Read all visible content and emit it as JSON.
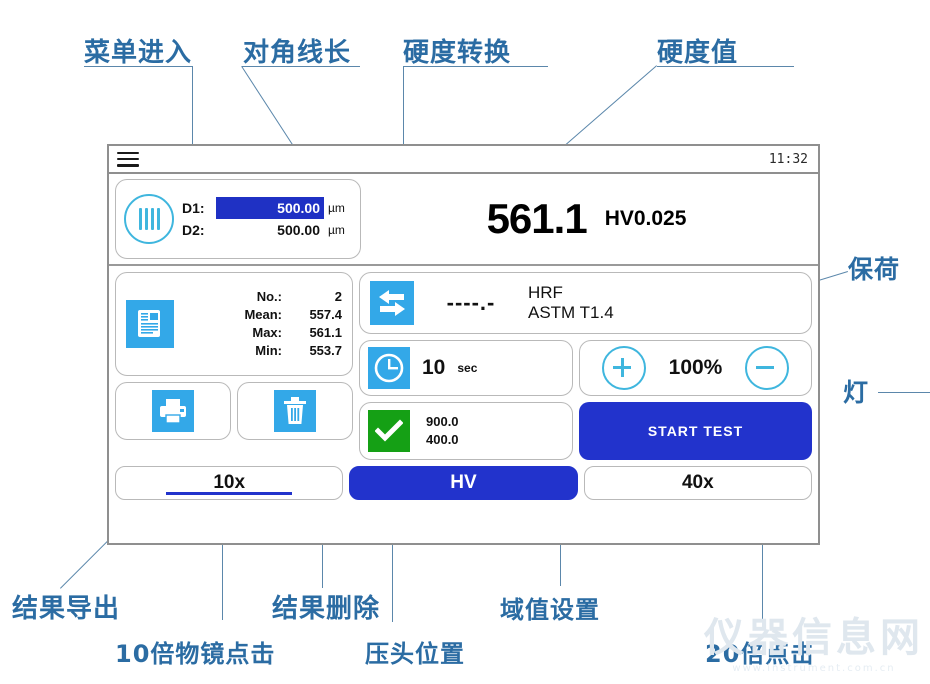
{
  "device": {
    "titlebar": {
      "menu_icon": "hamburger-menu-icon",
      "clock": "11:32"
    },
    "diagonal": {
      "icon": "indent-diagonal-icon",
      "rows": [
        {
          "label": "D1:",
          "value": "500.00",
          "unit": "µm",
          "selected": true
        },
        {
          "label": "D2:",
          "value": "500.00",
          "unit": "µm",
          "selected": false
        }
      ]
    },
    "hardness": {
      "value": "561.1",
      "scale": "HV0.025"
    },
    "stats": {
      "icon": "report-document-icon",
      "rows": [
        {
          "key": "No.:",
          "value": "2"
        },
        {
          "key": "Mean:",
          "value": "557.4"
        },
        {
          "key": "Max:",
          "value": "561.1"
        },
        {
          "key": "Min:",
          "value": "553.7"
        }
      ]
    },
    "tools": [
      {
        "name": "print-button",
        "icon": "printer-icon"
      },
      {
        "name": "delete-button",
        "icon": "trash-icon"
      }
    ],
    "conversion": {
      "icon": "convert-arrows-icon",
      "value": "----.-",
      "scale": "HRF",
      "standard": "ASTM T1.4"
    },
    "dwell": {
      "icon": "clock-icon",
      "value": "10",
      "unit": "sec"
    },
    "light": {
      "plus_icon": "plus-circle-icon",
      "minus_icon": "minus-circle-icon",
      "value": "100%"
    },
    "threshold": {
      "icon": "check-mark-icon",
      "upper": "900.0",
      "lower": "400.0"
    },
    "start_test": {
      "label": "START TEST"
    },
    "zoom_buttons": [
      {
        "label": "10x",
        "active": false,
        "underlined": true
      },
      {
        "label": "HV",
        "active": true,
        "underlined": false
      },
      {
        "label": "40x",
        "active": false,
        "underlined": false
      }
    ]
  },
  "annotations": {
    "menu_entry": "菜单进入",
    "diagonal_length": "对角线长",
    "hardness_conversion": "硬度转换",
    "hardness_value": "硬度值",
    "dwell_load": "保荷",
    "light": "灯",
    "export_result": "结果导出",
    "delete_result": "结果删除",
    "threshold_setting": "域值设置",
    "objective_10x": "10倍物镜点击",
    "indenter_position": "压头位置",
    "objective_20x": "20倍点击"
  },
  "watermark": {
    "text": "仪器信息网",
    "sub": "www.instrument.com.cn"
  },
  "colors": {
    "annotation": "#2b6ca3",
    "leader": "#5b87ab",
    "icon_blue": "#33a8e8",
    "accent_blue": "#2233cc",
    "outline_cyan": "#3fb6de",
    "green": "#15a015"
  }
}
